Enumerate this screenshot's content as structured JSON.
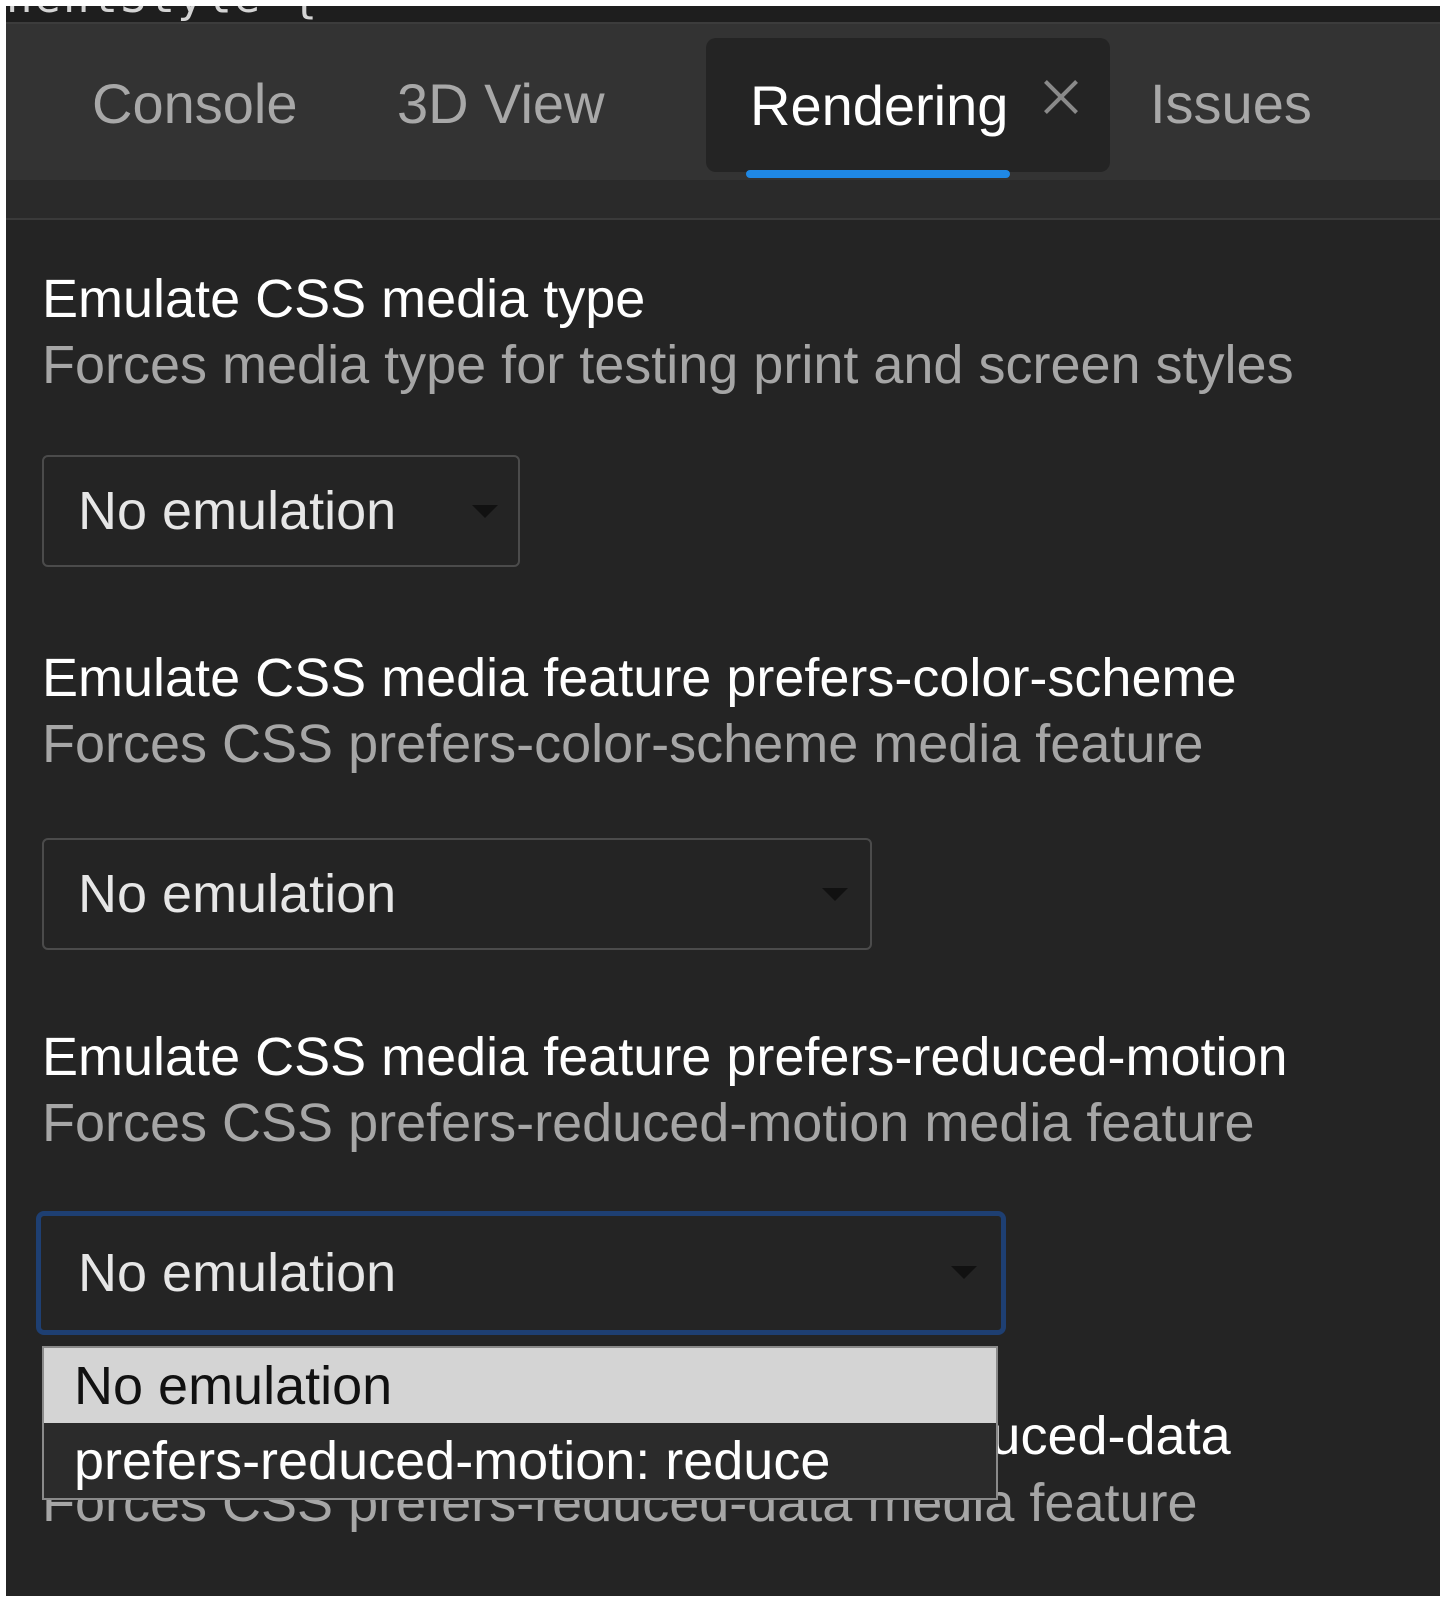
{
  "code_line": "nentStyle {",
  "tabs": {
    "console": "Console",
    "view3d": "3D View",
    "rendering": "Rendering",
    "issues": "Issues",
    "active": "Rendering",
    "close_icon": "close-icon"
  },
  "accent_color": "#1f88e5",
  "sections": {
    "media_type": {
      "title": "Emulate CSS media type",
      "description": "Forces media type for testing print and screen styles",
      "selected": "No emulation"
    },
    "color_scheme": {
      "title": "Emulate CSS media feature prefers-color-scheme",
      "description": "Forces CSS prefers-color-scheme media feature",
      "selected": "No emulation"
    },
    "reduced_motion": {
      "title": "Emulate CSS media feature prefers-reduced-motion",
      "description": "Forces CSS prefers-reduced-motion media feature",
      "selected": "No emulation",
      "options": [
        "No emulation",
        "prefers-reduced-motion: reduce"
      ]
    },
    "reduced_data": {
      "title": "Emulate CSS media feature prefers-reduced-data",
      "description": "Forces CSS prefers-reduced-data media feature"
    }
  }
}
